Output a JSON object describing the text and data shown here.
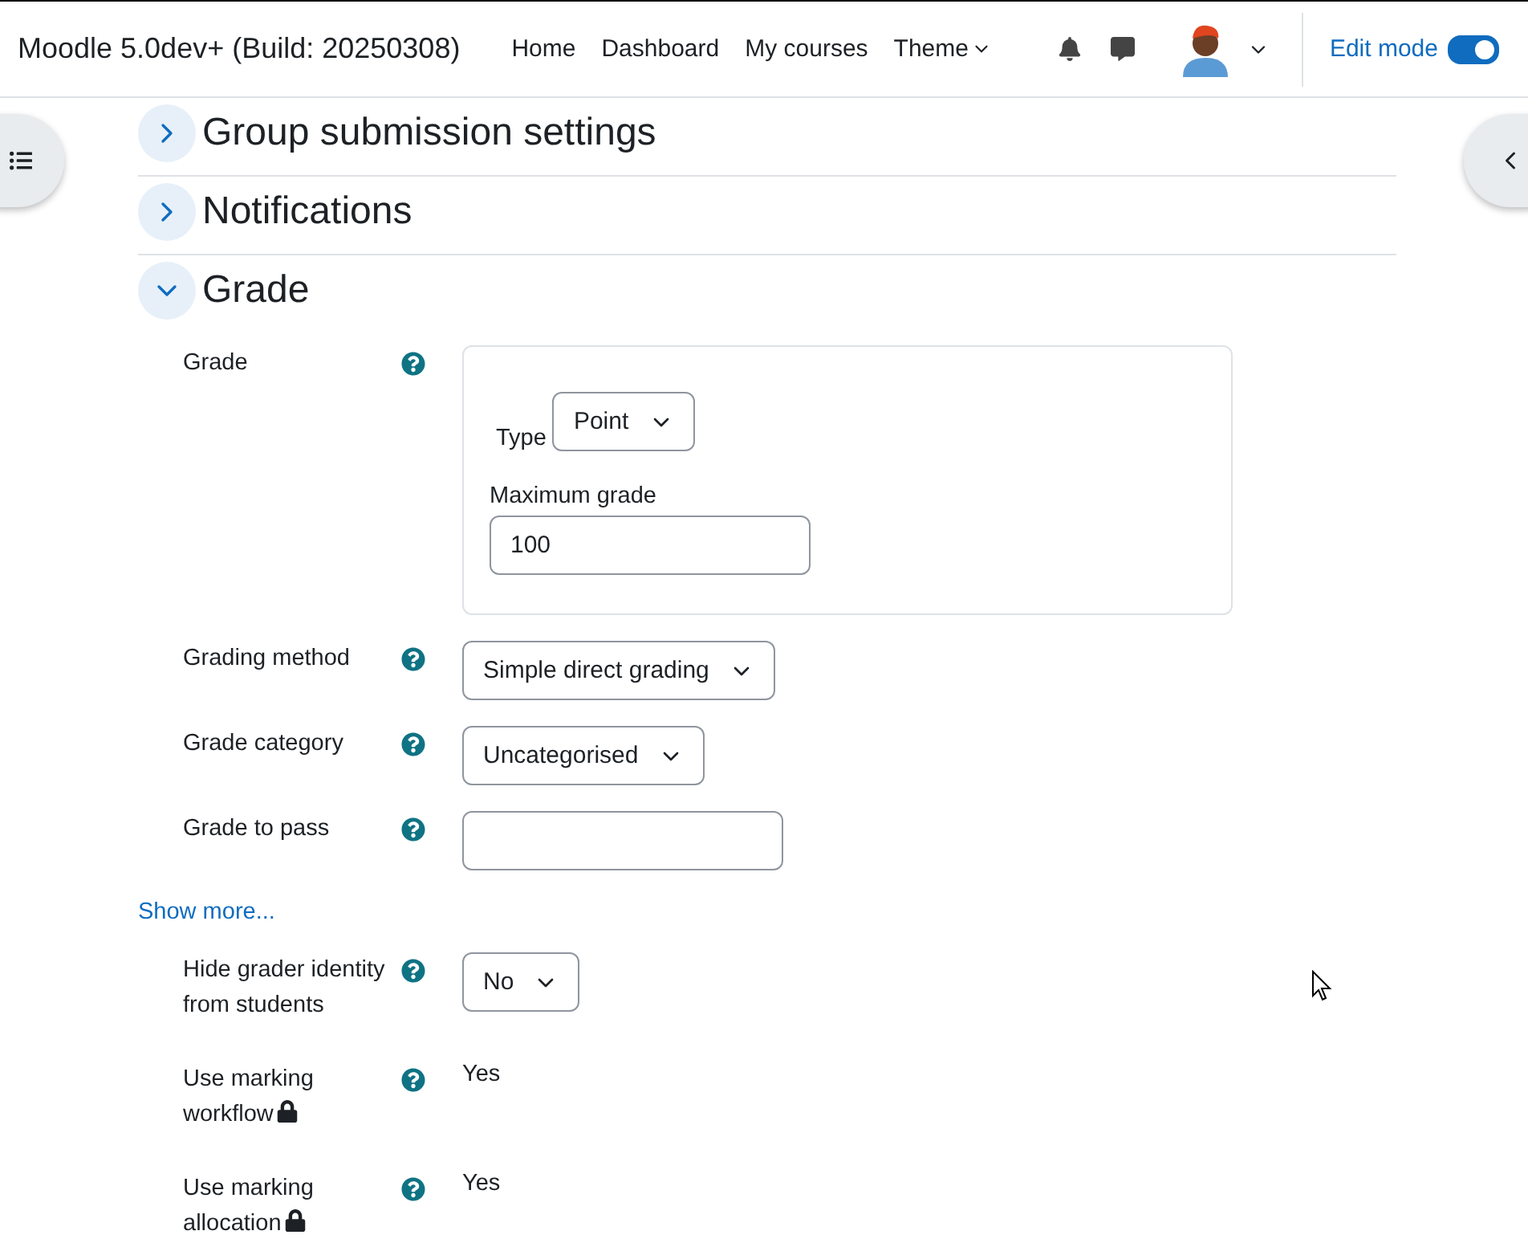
{
  "navbar": {
    "site_name": "Moodle 5.0dev+ (Build: 20250308)",
    "links": [
      {
        "label": "Home",
        "dropdown": false
      },
      {
        "label": "Dashboard",
        "dropdown": false
      },
      {
        "label": "My courses",
        "dropdown": false
      },
      {
        "label": "Theme",
        "dropdown": true
      }
    ],
    "edit_mode": {
      "label": "Edit mode",
      "on": true
    }
  },
  "sections": [
    {
      "title": "Group submission settings",
      "expanded": false
    },
    {
      "title": "Notifications",
      "expanded": false
    },
    {
      "title": "Grade",
      "expanded": true
    }
  ],
  "grade_fields": [
    {
      "kind": "group",
      "label": "Grade",
      "type_label": "Type",
      "type_value": "Point",
      "max_label": "Maximum grade",
      "max_value": "100"
    },
    {
      "kind": "select",
      "label": "Grading method",
      "value": "Simple direct grading"
    },
    {
      "kind": "select",
      "label": "Grade category",
      "value": "Uncategorised"
    },
    {
      "kind": "text",
      "label": "Grade to pass"
    }
  ],
  "show_more": "Show more...",
  "advanced_fields": [
    {
      "kind": "select",
      "label": "Hide grader identity from students",
      "value": "No"
    },
    {
      "kind": "static",
      "label": "Use marking workflow",
      "value": "Yes",
      "locked": true
    },
    {
      "kind": "static",
      "label": "Use marking allocation",
      "value": "Yes",
      "locked": true
    }
  ]
}
